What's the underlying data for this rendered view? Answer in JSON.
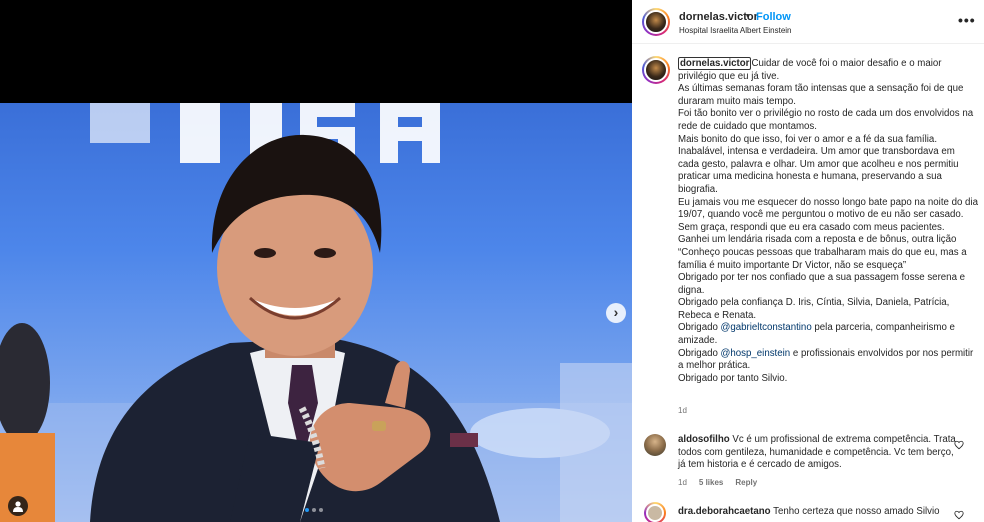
{
  "post": {
    "username": "dornelas.victor",
    "separator": "•",
    "follow_label": "Follow",
    "location": "Hospital Israelita Albert Einstein",
    "more_label": "•••"
  },
  "media": {
    "next_label": "›",
    "dots": 3,
    "active_dot": 0
  },
  "caption": {
    "username": "dornelas.victor",
    "lines": [
      "Cuidar de você foi o maior desafio e o maior privilégio que eu já tive.",
      "As últimas semanas foram tão intensas que a sensação foi de que duraram muito mais tempo.",
      "Foi tão bonito ver o privilégio no rosto de cada um dos envolvidos na rede de cuidado que montamos.",
      "Mais bonito do que isso, foi ver o amor e a fé da sua família. Inabalável, intensa e verdadeira. Um amor que transbordava em cada gesto, palavra e olhar. Um amor que acolheu e nos permitiu praticar uma medicina honesta e humana, preservando a sua biografia.",
      "Eu jamais vou me esquecer do nosso longo bate papo na noite do dia 19/07, quando você me perguntou o motivo de eu não ser casado. Sem graça, respondi que eu era casado com meus pacientes.",
      "Ganhei um lendária risada com a reposta e de bônus, outra lição “Conheço poucas pessoas que trabalharam mais do que eu, mas a família é muito importante Dr Victor, não se esqueça”",
      "Obrigado por ter nos confiado que a sua passagem fosse serena e digna.",
      "Obrigado pela confiança D. Iris, Cíntia, Silvia, Daniela, Patrícia, Rebeca e Renata."
    ],
    "thanks_1_pre": "Obrigado ",
    "thanks_1_mention": "@gabrieltconstantino",
    "thanks_1_post": " pela parceria, companheirismo e amizade.",
    "thanks_2_pre": "Obrigado ",
    "thanks_2_mention": "@hosp_einstein",
    "thanks_2_post": " e profissionais envolvidos por nos permitir a melhor prática.",
    "closing": "Obrigado por tanto Silvio.",
    "time": "1d"
  },
  "comments": [
    {
      "username": "aldosofilho",
      "text": " Vc é um profissional de extrema competência. Trata todos com gentileza, humanidade e competência. Vc tem berço, já tem historia e é cercado de amigos.",
      "time": "1d",
      "likes": "5 likes",
      "reply": "Reply"
    },
    {
      "username": "dra.deborahcaetano",
      "text": " Tenho certeza que nosso amado Silvio"
    }
  ],
  "colors": {
    "link_blue": "#0095f6",
    "mention_blue": "#00376b",
    "muted": "#737373",
    "text": "#262626",
    "carousel_active": "#2196f3"
  },
  "icons": [
    "more-options-icon",
    "chevron-right-icon",
    "user-tag-icon",
    "heart-icon"
  ]
}
